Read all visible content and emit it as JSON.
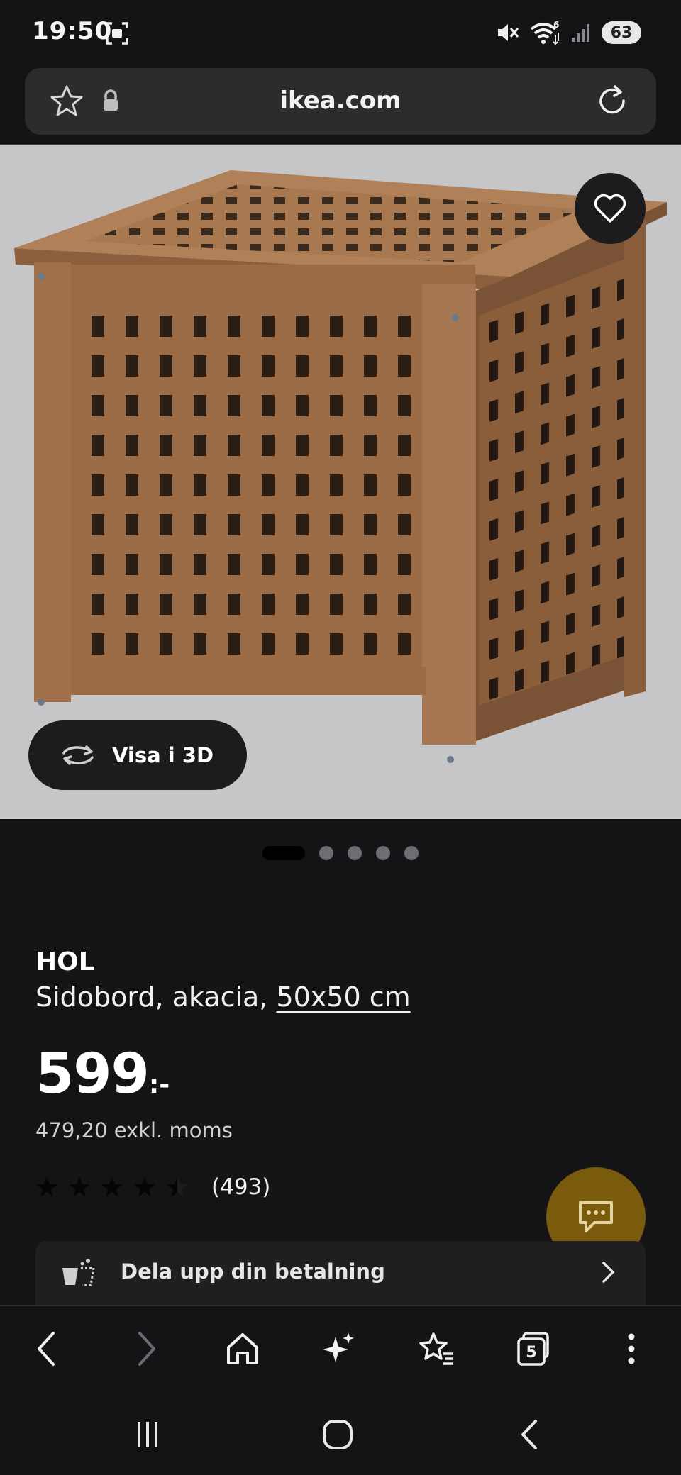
{
  "status_bar": {
    "time": "19:50",
    "battery": "63",
    "wifi_badge": "6"
  },
  "browser": {
    "url": "ikea.com",
    "tab_count": "5"
  },
  "product": {
    "view_3d_label": "Visa i 3D",
    "carousel": {
      "total": 5,
      "active": 0
    },
    "name": "HOL",
    "description": "Sidobord, akacia, ",
    "size": "50x50 cm",
    "price": "599",
    "price_suffix": ":-",
    "price_excl_vat": "479,20 exkl. moms",
    "rating": {
      "stars": 4.5,
      "max": 5,
      "count": "(493)"
    },
    "installment_label": "Dela upp din betalning"
  },
  "colors": {
    "background": "#141416",
    "chat_fab": "#7a5a0c",
    "image_background": "#c6c6c8"
  },
  "icons": {
    "toolbar": [
      "back-icon",
      "forward-icon",
      "home-icon",
      "sparkle-icon",
      "bookmark-star-icon",
      "tabs-icon",
      "more-icon"
    ],
    "system": [
      "recents-icon",
      "home-circle-icon",
      "system-back-icon"
    ]
  }
}
